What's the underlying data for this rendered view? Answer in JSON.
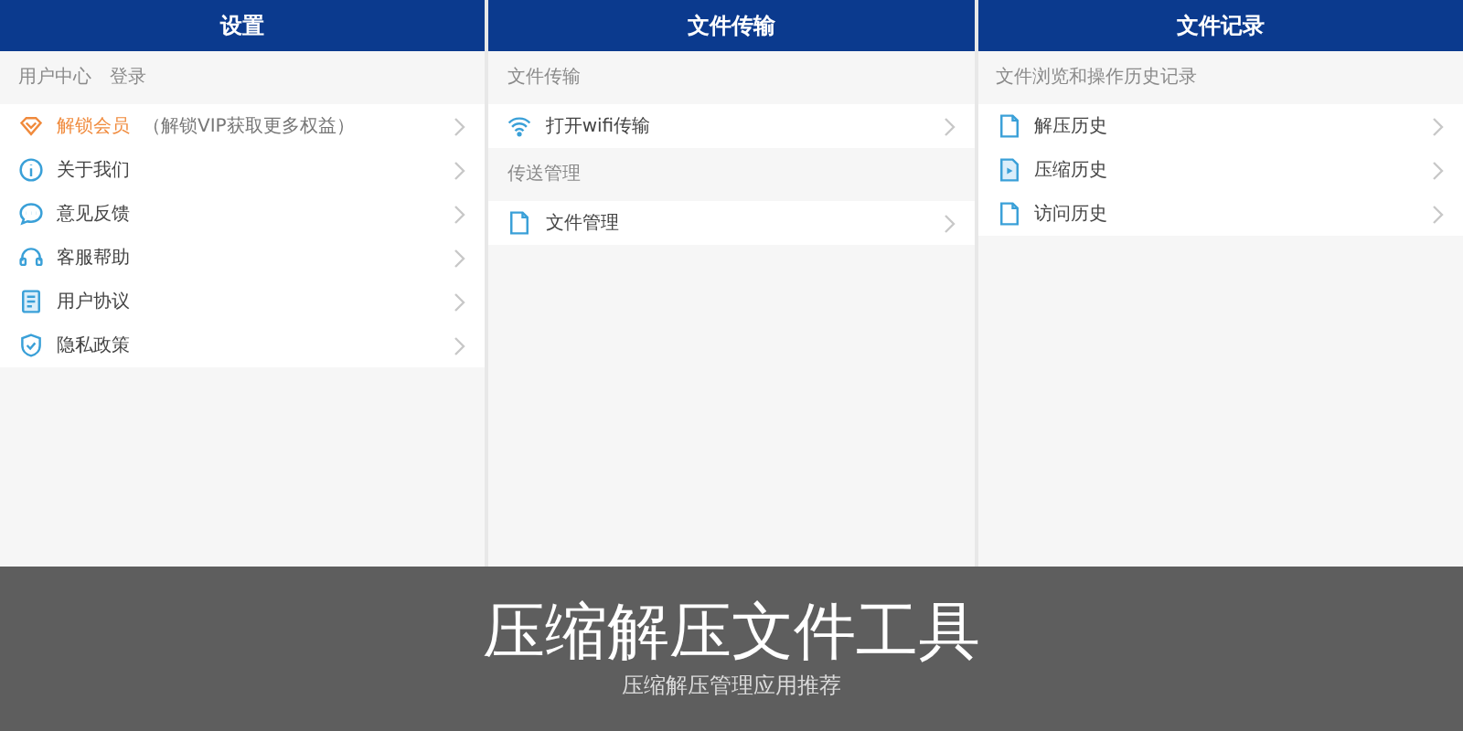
{
  "panels": [
    {
      "title": "设置",
      "sections": [
        {
          "header": "用户中心",
          "action": "登录",
          "rows": [
            {
              "label": "解锁会员",
              "note": "（解锁VIP获取更多权益）",
              "kind": "vip"
            },
            {
              "label": "关于我们",
              "kind": "normal"
            },
            {
              "label": "意见反馈",
              "kind": "normal"
            },
            {
              "label": "客服帮助",
              "kind": "normal"
            },
            {
              "label": "用户协议",
              "kind": "normal"
            },
            {
              "label": "隐私政策",
              "kind": "normal"
            }
          ]
        }
      ]
    },
    {
      "title": "文件传输",
      "sections": [
        {
          "header": "文件传输",
          "rows": [
            {
              "label": "打开wifi传输",
              "kind": "normal"
            }
          ]
        },
        {
          "header": "传送管理",
          "rows": [
            {
              "label": "文件管理",
              "kind": "normal"
            }
          ]
        }
      ]
    },
    {
      "title": "文件记录",
      "sections": [
        {
          "header": "文件浏览和操作历史记录",
          "rows": [
            {
              "label": "解压历史",
              "kind": "normal"
            },
            {
              "label": "压缩历史",
              "kind": "normal"
            },
            {
              "label": "访问历史",
              "kind": "normal"
            }
          ]
        }
      ]
    }
  ],
  "banner": {
    "title": "压缩解压文件工具",
    "subtitle": "压缩解压管理应用推荐"
  }
}
